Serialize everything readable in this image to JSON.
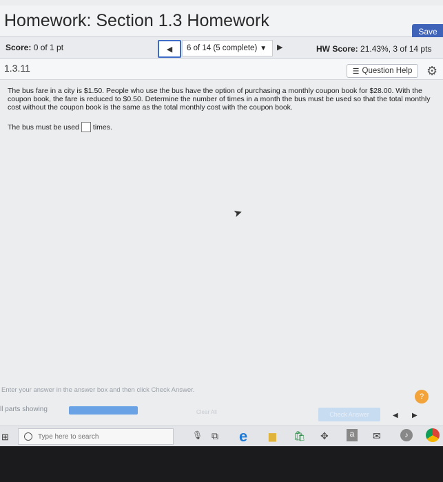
{
  "header": {
    "title": "Homework: Section 1.3 Homework",
    "save_label": "Save"
  },
  "scorebar": {
    "score_label": "Score:",
    "score_value": "0 of 1 pt",
    "question_nav": "6 of 14 (5 complete)",
    "hw_score_label": "HW Score:",
    "hw_score_value": "21.43%, 3 of 14 pts"
  },
  "question": {
    "number": "1.3.11",
    "help_label": "Question Help",
    "text": "The bus fare in a city is $1.50. People who use the bus have the option of purchasing a monthly coupon book for $28.00. With the coupon book, the fare is reduced to $0.50. Determine the number of times in a month the bus must be used so that the total monthly cost without the coupon book is the same as the total monthly cost with the coupon book.",
    "answer_prefix": "The bus must be used",
    "answer_value": "",
    "answer_suffix": "times."
  },
  "footer": {
    "instruction": "Enter your answer in the answer box and then click Check Answer.",
    "help_symbol": "?",
    "parts_label": "ll parts showing",
    "progress_fraction": 1.0,
    "clear_label": "Clear All",
    "check_label": "Check Answer"
  },
  "taskbar": {
    "search_placeholder": "Type here to search",
    "store_letter": "a"
  },
  "icons": {
    "prev": "triangle-left-icon",
    "next": "triangle-right-icon",
    "menu": "list-icon",
    "settings": "gear-icon"
  },
  "colors": {
    "accent": "#3e63b9",
    "progress": "#6aa2e6",
    "help": "#f2a33a"
  }
}
